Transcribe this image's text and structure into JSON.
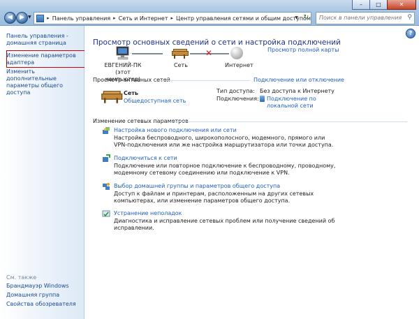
{
  "window": {
    "minimize": "–",
    "maximize": "□",
    "close": "✕"
  },
  "nav": {
    "back_icon": "arrow-left-icon",
    "forward_icon": "arrow-right-icon",
    "back": "◀",
    "forward": "▶"
  },
  "breadcrumb": [
    "Панель управления",
    "Сеть и Интернет",
    "Центр управления сетями и общим доступом"
  ],
  "search": {
    "placeholder": "Поиск в панели управления"
  },
  "sidebar": {
    "home": "Панель управления - домашняя страница",
    "items": [
      {
        "label": "Изменение параметров адаптера"
      },
      {
        "label": "Изменить дополнительные параметры общего доступа"
      }
    ],
    "see_also_title": "См. также",
    "see_also": [
      "Брандмауэр Windows",
      "Домашняя группа",
      "Свойства обозревателя"
    ]
  },
  "main": {
    "title": "Просмотр основных сведений о сети и настройка подключений",
    "full_map": "Просмотр полной карты",
    "map": {
      "computer": "ЕВГЕНИЙ-ПК",
      "computer_sub": "(этот компьютер)",
      "network": "Сеть",
      "internet": "Интернет"
    },
    "active_title": "Просмотр активных сетей",
    "connect_toggle": "Подключение или отключение",
    "active_network": {
      "name": "Сеть",
      "type": "Общедоступная сеть",
      "access_label": "Тип доступа:",
      "access_value": "Без доступа к Интернету",
      "connections_label": "Подключения:",
      "connections_value": "Подключение по локальной сети"
    },
    "settings_title": "Изменение сетевых параметров",
    "tasks": [
      {
        "title": "Настройка нового подключения или сети",
        "desc": "Настройка беспроводного, широкополосного, модемного, прямого или VPN-подключения или же настройка маршрутизатора или точки доступа."
      },
      {
        "title": "Подключиться к сети",
        "desc": "Подключение или повторное подключение к беспроводному, проводному, модемному сетевому соединению или подключение к VPN."
      },
      {
        "title": "Выбор домашней группы и параметров общего доступа",
        "desc": "Доступ к файлам и принтерам, расположенным на других сетевых компьютерах, или изменение параметров общего доступа."
      },
      {
        "title": "Устранение неполадок",
        "desc": "Диагностика и исправление сетевых проблем или получение сведений об исправлении."
      }
    ]
  },
  "help": "?"
}
